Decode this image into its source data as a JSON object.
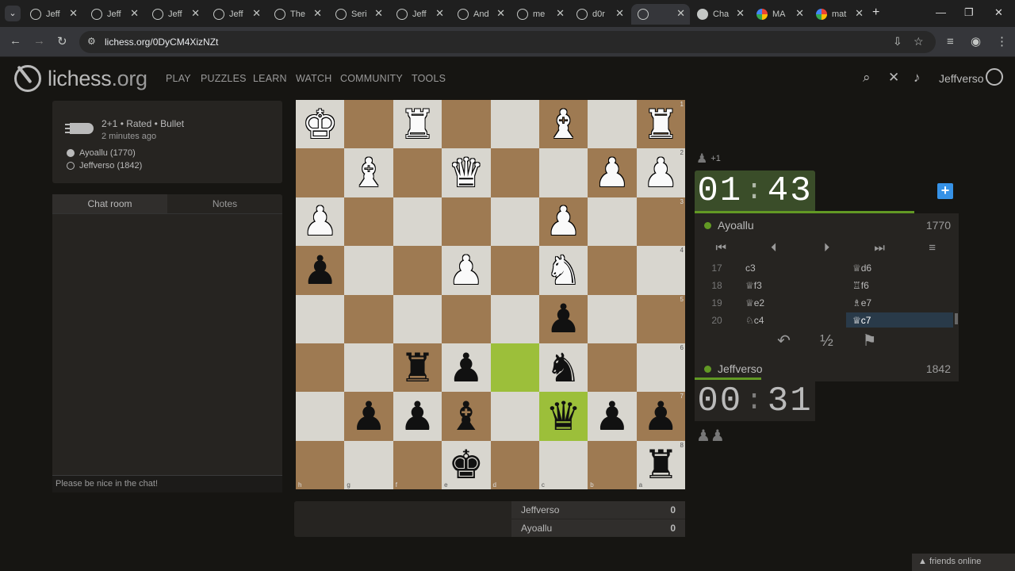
{
  "browser": {
    "tabs": [
      {
        "title": "Jeff",
        "active": false,
        "icon": "lichess"
      },
      {
        "title": "Jeff",
        "active": false,
        "icon": "lichess"
      },
      {
        "title": "Jeff",
        "active": false,
        "icon": "lichess"
      },
      {
        "title": "Jeff",
        "active": false,
        "icon": "lichess"
      },
      {
        "title": "The",
        "active": false,
        "icon": "lichess"
      },
      {
        "title": "Seri",
        "active": false,
        "icon": "lichess"
      },
      {
        "title": "Jeff",
        "active": false,
        "icon": "lichess"
      },
      {
        "title": "And",
        "active": false,
        "icon": "lichess"
      },
      {
        "title": "me",
        "active": false,
        "icon": "lichess"
      },
      {
        "title": "d0r",
        "active": false,
        "icon": "lichess"
      },
      {
        "title": "",
        "active": true,
        "icon": "lichess"
      },
      {
        "title": "Cha",
        "active": false,
        "icon": "openai"
      },
      {
        "title": "MA",
        "active": false,
        "icon": "google"
      },
      {
        "title": "mat",
        "active": false,
        "icon": "google"
      }
    ],
    "url": "lichess.org/0DyCM4XizNZt"
  },
  "header": {
    "logo": "lichess",
    "logo_suffix": ".org",
    "nav": [
      "PLAY",
      "PUZZLES",
      "LEARN",
      "WATCH",
      "COMMUNITY",
      "TOOLS"
    ],
    "username": "Jeffverso"
  },
  "game_info": {
    "setup": "2+1 • Rated • Bullet",
    "time_ago": "2 minutes ago",
    "white_player": "Ayoallu (1770)",
    "black_player": "Jeffverso (1842)"
  },
  "chat": {
    "tab_chat": "Chat room",
    "tab_notes": "Notes",
    "placeholder": "Please be nice in the chat!"
  },
  "board": {
    "orientation": "black",
    "ranks": [
      [
        "wK",
        "",
        "wR",
        "",
        "",
        "wB",
        "",
        "wR"
      ],
      [
        "",
        "wB",
        "",
        "wQ",
        "",
        "",
        "wP",
        "wP"
      ],
      [
        "wP",
        "",
        "",
        "",
        "",
        "wP",
        "",
        ""
      ],
      [
        "bP",
        "",
        "",
        "wP",
        "",
        "wN",
        "",
        ""
      ],
      [
        "",
        "",
        "",
        "",
        "",
        "bP",
        "",
        ""
      ],
      [
        "",
        "",
        "bR",
        "bP",
        "",
        "bN",
        "",
        ""
      ],
      [
        "",
        "bP",
        "bP",
        "bB",
        "",
        "bQ",
        "bP",
        "bP"
      ],
      [
        "",
        "",
        "",
        "bK",
        "",
        "",
        "",
        "bR"
      ]
    ],
    "rank_labels": [
      "1",
      "2",
      "3",
      "4",
      "5",
      "6",
      "7",
      "8"
    ],
    "file_labels": [
      "h",
      "g",
      "f",
      "e",
      "d",
      "c",
      "b",
      "a"
    ],
    "highlight": [
      [
        5,
        4
      ],
      [
        6,
        5
      ]
    ],
    "light_color": "#d8d6cf",
    "dark_color": "#9e7a52",
    "highlight_color": "#9cbf3a"
  },
  "right_panel": {
    "material_top": "+1",
    "clock_top": {
      "min": "01",
      "sec": "43"
    },
    "clock_bottom": {
      "min": "00",
      "sec": "31"
    },
    "top_player": {
      "name": "Ayoallu",
      "rating": "1770"
    },
    "bottom_player": {
      "name": "Jeffverso",
      "rating": "1842"
    },
    "moves": [
      {
        "n": "17",
        "w": "c3",
        "b": "♕d6"
      },
      {
        "n": "18",
        "w": "♕f3",
        "b": "♖f6"
      },
      {
        "n": "19",
        "w": "♕e2",
        "b": "♗e7"
      },
      {
        "n": "20",
        "w": "♘c4",
        "b": "♕c7"
      }
    ],
    "draw_label": "½"
  },
  "scoreboard": {
    "rows": [
      {
        "name": "Jeffverso",
        "score": "0"
      },
      {
        "name": "Ayoallu",
        "score": "0"
      }
    ]
  },
  "footer": {
    "friends": "friends online"
  }
}
